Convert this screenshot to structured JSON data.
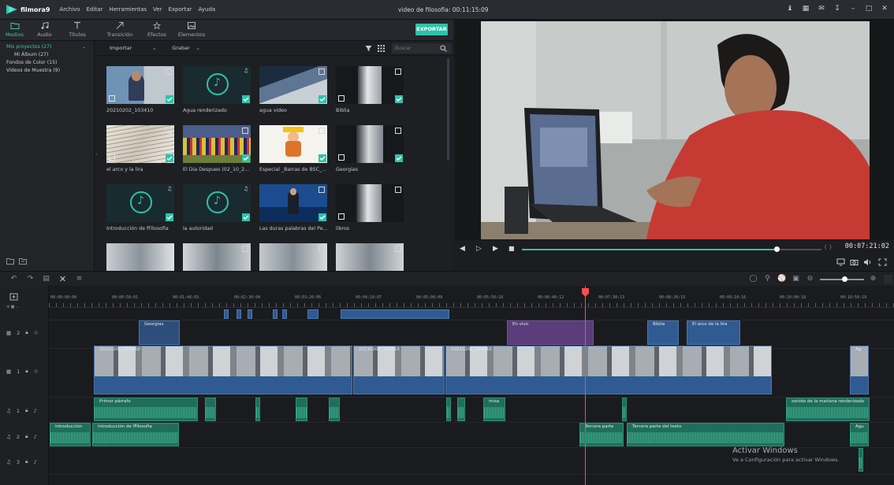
{
  "app": {
    "logo_text": "filmora9",
    "window_title": "video de filosofia: 00:11:15:09",
    "menu": [
      "Archivo",
      "Editar",
      "Herramientas",
      "Ver",
      "Exportar",
      "Ayuda"
    ]
  },
  "media_tabs": {
    "medios": "Medios",
    "audio": "Audio",
    "titulos": "Títulos",
    "transicion": "Transición",
    "efectos": "Efectos",
    "elementos": "Elementos",
    "export": "EXPORTAR"
  },
  "folders": [
    {
      "label": "Mis proyectos (27)",
      "selected": true
    },
    {
      "label": "Mi Álbum (27)",
      "sub": true
    },
    {
      "label": "Fondos de Color (15)"
    },
    {
      "label": "Videos de Muestra (9)"
    }
  ],
  "library": {
    "import_label": "Importar",
    "record_label": "Grabar",
    "search_placeholder": "Buscar",
    "items": [
      {
        "caption": "20210202_103410",
        "kind": "video"
      },
      {
        "caption": "Agua renderizado",
        "kind": "audio"
      },
      {
        "caption": "agua video",
        "kind": "video"
      },
      {
        "caption": "Biblia",
        "kind": "video"
      },
      {
        "caption": "el arco y la lira",
        "kind": "video"
      },
      {
        "caption": "El Dia Despues (02_10_2...",
        "kind": "video"
      },
      {
        "caption": "Especial _Barras de BSC_...",
        "kind": "video"
      },
      {
        "caption": "Georgias",
        "kind": "video"
      },
      {
        "caption": "Introducción de fFilosofia",
        "kind": "audio"
      },
      {
        "caption": "la autoridad",
        "kind": "audio"
      },
      {
        "caption": "Las duras palabras del Pe...",
        "kind": "video"
      },
      {
        "caption": "libros",
        "kind": "video"
      },
      {
        "caption": "",
        "kind": "video"
      },
      {
        "caption": "",
        "kind": "video"
      },
      {
        "caption": "",
        "kind": "video"
      },
      {
        "caption": "",
        "kind": "video"
      }
    ]
  },
  "preview": {
    "timecode": "00:07:21:02",
    "progress": 0.85,
    "brackets": "{ }"
  },
  "timeline": {
    "ruler_labels": [
      "00:00:00:00",
      "00:00:50:01",
      "00:01:40:03",
      "00:02:30:04",
      "00:03:20:06",
      "00:04:10:07",
      "00:05:00:09",
      "00:05:50:10",
      "00:06:40:12",
      "00:07:30:13",
      "00:08:20:15",
      "00:09:10:16",
      "00:10:00:18",
      "00:10:50:19"
    ],
    "tracks": [
      "2",
      "1",
      "1",
      "2",
      "3"
    ],
    "clips": {
      "georgias": "Georgias",
      "effect": "En vivo",
      "biblia": "Biblia",
      "arco": "El arco de la lira",
      "main_a": "20210202_103410",
      "main_b": "20210202_103410",
      "main_c": "20210202_103410",
      "right_clip": "Ag",
      "primer": "Primer párrafo",
      "misa": "misa",
      "sonido": "sonido de la mañana renderizado",
      "intro_short": "Introducción",
      "intro_long": "Introducción de fFilosofia",
      "tercera_a": "Tercera parte",
      "tercera_b": "Tercera parte del texto",
      "agu": "Agu"
    }
  },
  "watermark": {
    "title": "Activar Windows",
    "subtitle": "Ve a Configuración para activar Windows."
  }
}
